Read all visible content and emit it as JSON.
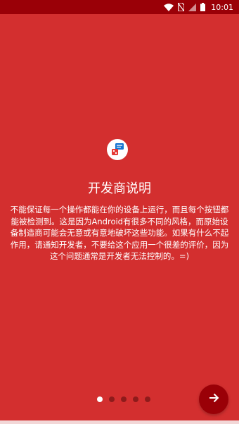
{
  "status_bar": {
    "time": "10:01",
    "icons": [
      "wifi-icon",
      "no-sim-icon",
      "cellular-signal-icon",
      "battery-icon"
    ]
  },
  "intro": {
    "icon": "developer-notice-app-icon",
    "title": "开发商说明",
    "description": "不能保证每一个操作都能在你的设备上运行，而且每个按钮都能被检测到。这是因为Android有很多不同的风格，而原始设备制造商可能会无意或有意地破坏这些功能。如果有什么不起作用，请通知开发者，不要给这个应用一个很差的评价，因为这个问题通常是开发者无法控制的。=)"
  },
  "pager": {
    "total_pages": 5,
    "current_page": 1
  },
  "next_button": {
    "icon": "arrow-right-icon"
  },
  "colors": {
    "background": "#d32f2f",
    "status_bar": "#9a0007",
    "accent_button": "#9a0007",
    "inactive_dot": "#8e1b1b",
    "text": "#ffffff"
  }
}
